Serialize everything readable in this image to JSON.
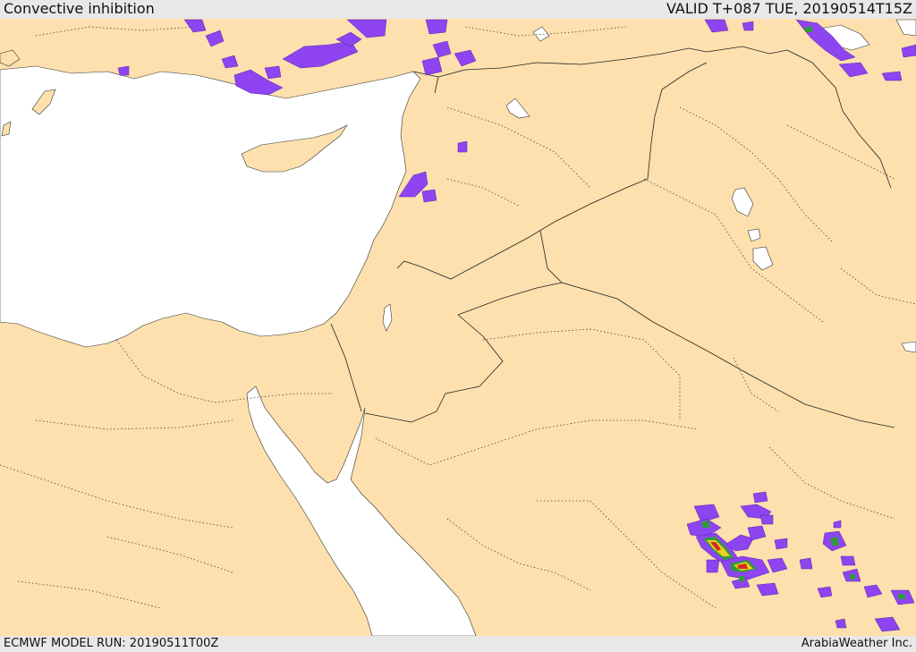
{
  "header": {
    "title": "Convective inhibition",
    "valid": "VALID T+087 TUE, 20190514T15Z"
  },
  "footer": {
    "model_run": "ECMWF MODEL RUN: 20190511T00Z",
    "credit": "ArabiaWeather Inc."
  },
  "colors": {
    "land": "#fde0ad",
    "water": "#ffffff",
    "cin_low": "#8e44f0",
    "cin_mid": "#2e9b3e",
    "cin_high": "#e8d21a",
    "cin_max": "#d42a1f"
  }
}
